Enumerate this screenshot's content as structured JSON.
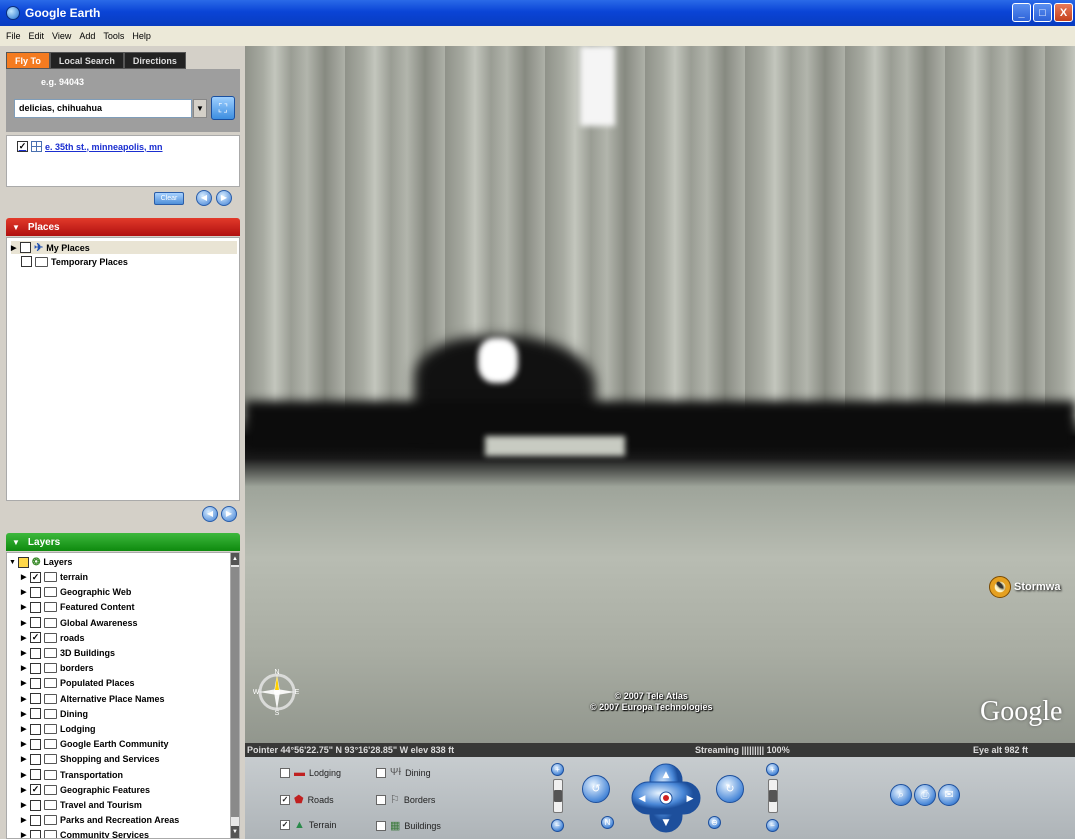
{
  "window": {
    "title": "Google Earth",
    "buttons": [
      "_",
      "□",
      "X"
    ]
  },
  "menu": [
    "File",
    "Edit",
    "View",
    "Add",
    "Tools",
    "Help"
  ],
  "tabs": [
    {
      "label": "Fly To",
      "active": true
    },
    {
      "label": "Local Search",
      "active": false
    },
    {
      "label": "Directions",
      "active": false
    }
  ],
  "flyto": {
    "example": "e.g. 94043",
    "query": "delicias, chihuahua",
    "dropdown_icon": "▼",
    "go_icon": "⛶"
  },
  "results": {
    "item": "e. 35th st., minneapolis, mn",
    "checked": true
  },
  "results_footer": {
    "clear_label": "Clear",
    "prev": "◀",
    "next": "▶"
  },
  "places": {
    "header": "Places",
    "items": [
      {
        "label": "My Places",
        "checked": false
      },
      {
        "label": "Temporary Places",
        "checked": false
      }
    ]
  },
  "places_footer": {
    "prev": "◀",
    "next": "▶"
  },
  "layers": {
    "header": "Layers",
    "root": "Layers",
    "items": [
      {
        "label": "terrain",
        "checked": true
      },
      {
        "label": "Geographic Web",
        "checked": false
      },
      {
        "label": "Featured Content",
        "checked": false
      },
      {
        "label": "Global Awareness",
        "checked": false
      },
      {
        "label": "roads",
        "checked": true
      },
      {
        "label": "3D Buildings",
        "checked": false
      },
      {
        "label": "borders",
        "checked": false
      },
      {
        "label": "Populated Places",
        "checked": false
      },
      {
        "label": "Alternative Place Names",
        "checked": false
      },
      {
        "label": "Dining",
        "checked": false
      },
      {
        "label": "Lodging",
        "checked": false
      },
      {
        "label": "Google Earth Community",
        "checked": false
      },
      {
        "label": "Shopping and Services",
        "checked": false
      },
      {
        "label": "Transportation",
        "checked": false
      },
      {
        "label": "Geographic Features",
        "checked": true
      },
      {
        "label": "Travel and Tourism",
        "checked": false
      },
      {
        "label": "Parks and Recreation Areas",
        "checked": false
      },
      {
        "label": "Community Services",
        "checked": false
      }
    ]
  },
  "map": {
    "copyright_1": "© 2007 Tele Atlas",
    "copyright_2": "© 2007 Europa Technologies",
    "logo": "Google",
    "poi_label": "Stormwa",
    "compass": {
      "n": "N",
      "s": "S",
      "e": "E",
      "w": "W"
    }
  },
  "status": {
    "pointer": "Pointer  44°56'22.75\" N   93°16'28.85\" W   elev  838 ft",
    "streaming": "Streaming ||||||||| 100%",
    "eye": "Eye  alt     982 ft"
  },
  "bottom_layers": [
    {
      "label": "Lodging",
      "checked": false
    },
    {
      "label": "Dining",
      "checked": false
    },
    {
      "label": "Roads",
      "checked": true
    },
    {
      "label": "Borders",
      "checked": false
    },
    {
      "label": "Terrain",
      "checked": true
    },
    {
      "label": "Buildings",
      "checked": false
    }
  ],
  "nav": {
    "tilt_up": "+",
    "tilt_down": "−",
    "rotate_left": "↺",
    "rotate_right": "↻",
    "north": "N",
    "reset": "⊖",
    "zoom_in": "+",
    "zoom_out": "−",
    "dpad_up": "▲",
    "dpad_down": "▼",
    "dpad_left": "◀",
    "dpad_right": "▶",
    "print": "⎙",
    "email": "✉",
    "search": "⌕"
  }
}
